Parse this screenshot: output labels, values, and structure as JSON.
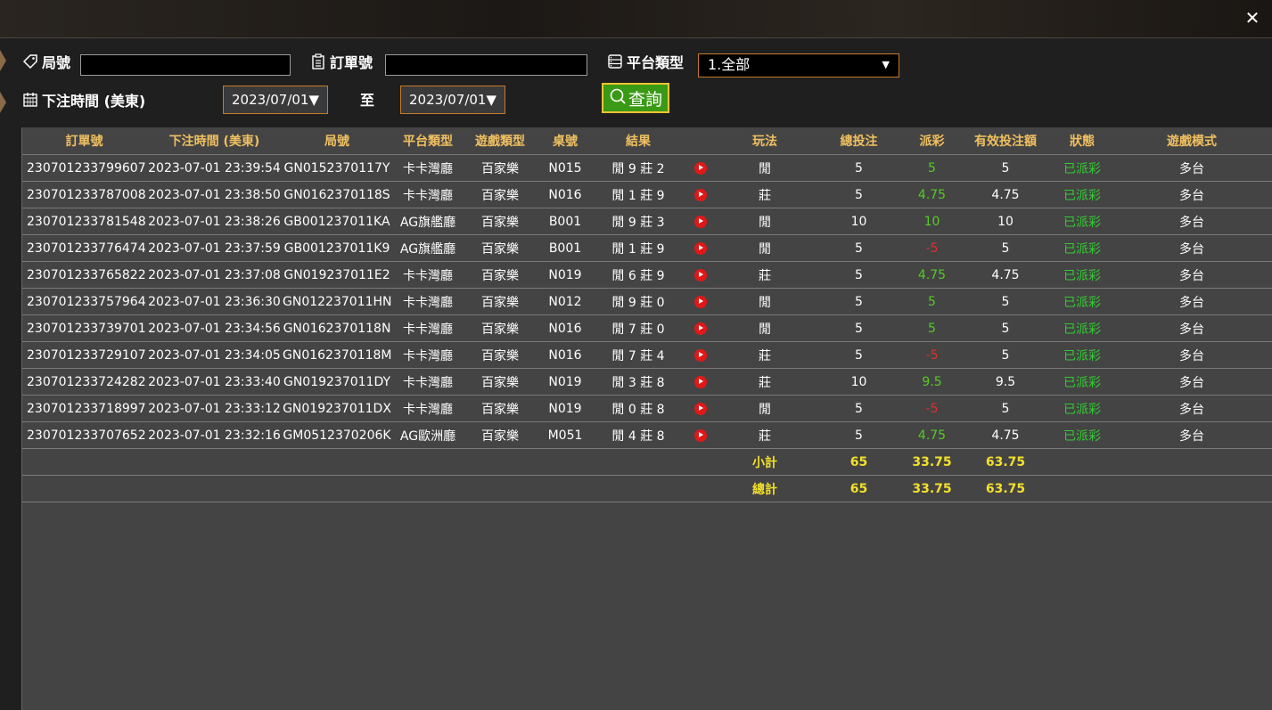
{
  "window": {
    "close_label": "✕"
  },
  "filters": {
    "round_label": "局號",
    "order_label": "訂單號",
    "platform_label": "平台類型",
    "platform_selected": "1.全部",
    "bet_time_label": "下注時間 (美東)",
    "date_from": "2023/07/01▼",
    "to_label": "至",
    "date_to": "2023/07/01▼",
    "query_label": "查詢"
  },
  "table": {
    "headers": [
      "訂單號",
      "下注時間 (美東)",
      "局號",
      "平台類型",
      "遊戲類型",
      "桌號",
      "結果",
      "",
      "玩法",
      "總投注",
      "派彩",
      "有效投注額",
      "狀態",
      "遊戲模式"
    ],
    "rows": [
      {
        "order": "230701233799607",
        "time": "2023-07-01 23:39:54",
        "round": "GN0152370117Y",
        "platform": "卡卡灣廳",
        "game": "百家樂",
        "table": "N015",
        "result": "閒 9 莊 2",
        "bet_type": "閒",
        "total": "5",
        "payout": "5",
        "payout_sign": "pos",
        "valid": "5",
        "status": "已派彩",
        "mode": "多台"
      },
      {
        "order": "230701233787008",
        "time": "2023-07-01 23:38:50",
        "round": "GN0162370118S",
        "platform": "卡卡灣廳",
        "game": "百家樂",
        "table": "N016",
        "result": "閒 1 莊 9",
        "bet_type": "莊",
        "total": "5",
        "payout": "4.75",
        "payout_sign": "pos",
        "valid": "4.75",
        "status": "已派彩",
        "mode": "多台"
      },
      {
        "order": "230701233781548",
        "time": "2023-07-01 23:38:26",
        "round": "GB001237011KA",
        "platform": "AG旗艦廳",
        "game": "百家樂",
        "table": "B001",
        "result": "閒 9 莊 3",
        "bet_type": "閒",
        "total": "10",
        "payout": "10",
        "payout_sign": "pos",
        "valid": "10",
        "status": "已派彩",
        "mode": "多台"
      },
      {
        "order": "230701233776474",
        "time": "2023-07-01 23:37:59",
        "round": "GB001237011K9",
        "platform": "AG旗艦廳",
        "game": "百家樂",
        "table": "B001",
        "result": "閒 1 莊 9",
        "bet_type": "閒",
        "total": "5",
        "payout": "-5",
        "payout_sign": "neg",
        "valid": "5",
        "status": "已派彩",
        "mode": "多台"
      },
      {
        "order": "230701233765822",
        "time": "2023-07-01 23:37:08",
        "round": "GN019237011E2",
        "platform": "卡卡灣廳",
        "game": "百家樂",
        "table": "N019",
        "result": "閒 6 莊 9",
        "bet_type": "莊",
        "total": "5",
        "payout": "4.75",
        "payout_sign": "pos",
        "valid": "4.75",
        "status": "已派彩",
        "mode": "多台"
      },
      {
        "order": "230701233757964",
        "time": "2023-07-01 23:36:30",
        "round": "GN012237011HN",
        "platform": "卡卡灣廳",
        "game": "百家樂",
        "table": "N012",
        "result": "閒 9 莊 0",
        "bet_type": "閒",
        "total": "5",
        "payout": "5",
        "payout_sign": "pos",
        "valid": "5",
        "status": "已派彩",
        "mode": "多台"
      },
      {
        "order": "230701233739701",
        "time": "2023-07-01 23:34:56",
        "round": "GN0162370118N",
        "platform": "卡卡灣廳",
        "game": "百家樂",
        "table": "N016",
        "result": "閒 7 莊 0",
        "bet_type": "閒",
        "total": "5",
        "payout": "5",
        "payout_sign": "pos",
        "valid": "5",
        "status": "已派彩",
        "mode": "多台"
      },
      {
        "order": "230701233729107",
        "time": "2023-07-01 23:34:05",
        "round": "GN0162370118M",
        "platform": "卡卡灣廳",
        "game": "百家樂",
        "table": "N016",
        "result": "閒 7 莊 4",
        "bet_type": "莊",
        "total": "5",
        "payout": "-5",
        "payout_sign": "neg",
        "valid": "5",
        "status": "已派彩",
        "mode": "多台"
      },
      {
        "order": "230701233724282",
        "time": "2023-07-01 23:33:40",
        "round": "GN019237011DY",
        "platform": "卡卡灣廳",
        "game": "百家樂",
        "table": "N019",
        "result": "閒 3 莊 8",
        "bet_type": "莊",
        "total": "10",
        "payout": "9.5",
        "payout_sign": "pos",
        "valid": "9.5",
        "status": "已派彩",
        "mode": "多台"
      },
      {
        "order": "230701233718997",
        "time": "2023-07-01 23:33:12",
        "round": "GN019237011DX",
        "platform": "卡卡灣廳",
        "game": "百家樂",
        "table": "N019",
        "result": "閒 0 莊 8",
        "bet_type": "閒",
        "total": "5",
        "payout": "-5",
        "payout_sign": "neg",
        "valid": "5",
        "status": "已派彩",
        "mode": "多台"
      },
      {
        "order": "230701233707652",
        "time": "2023-07-01 23:32:16",
        "round": "GM0512370206K",
        "platform": "AG歐洲廳",
        "game": "百家樂",
        "table": "M051",
        "result": "閒 4 莊 8",
        "bet_type": "莊",
        "total": "5",
        "payout": "4.75",
        "payout_sign": "pos",
        "valid": "4.75",
        "status": "已派彩",
        "mode": "多台"
      }
    ],
    "subtotal": {
      "label": "小計",
      "total": "65",
      "payout": "33.75",
      "valid": "63.75"
    },
    "grand_total": {
      "label": "總計",
      "total": "65",
      "payout": "33.75",
      "valid": "63.75"
    }
  },
  "icons": {
    "tag": "tag-icon",
    "clipboard": "clipboard-icon",
    "list": "list-icon",
    "calendar": "calendar-icon",
    "search": "search-icon",
    "play": "play-icon"
  },
  "colors": {
    "header_text": "#f0c060",
    "payout_positive": "#55cc22",
    "payout_negative": "#e03030",
    "status": "#33cc33",
    "summary": "#f2e02a",
    "query_button": "#3a9a15",
    "accent_border": "#c47a2a"
  }
}
